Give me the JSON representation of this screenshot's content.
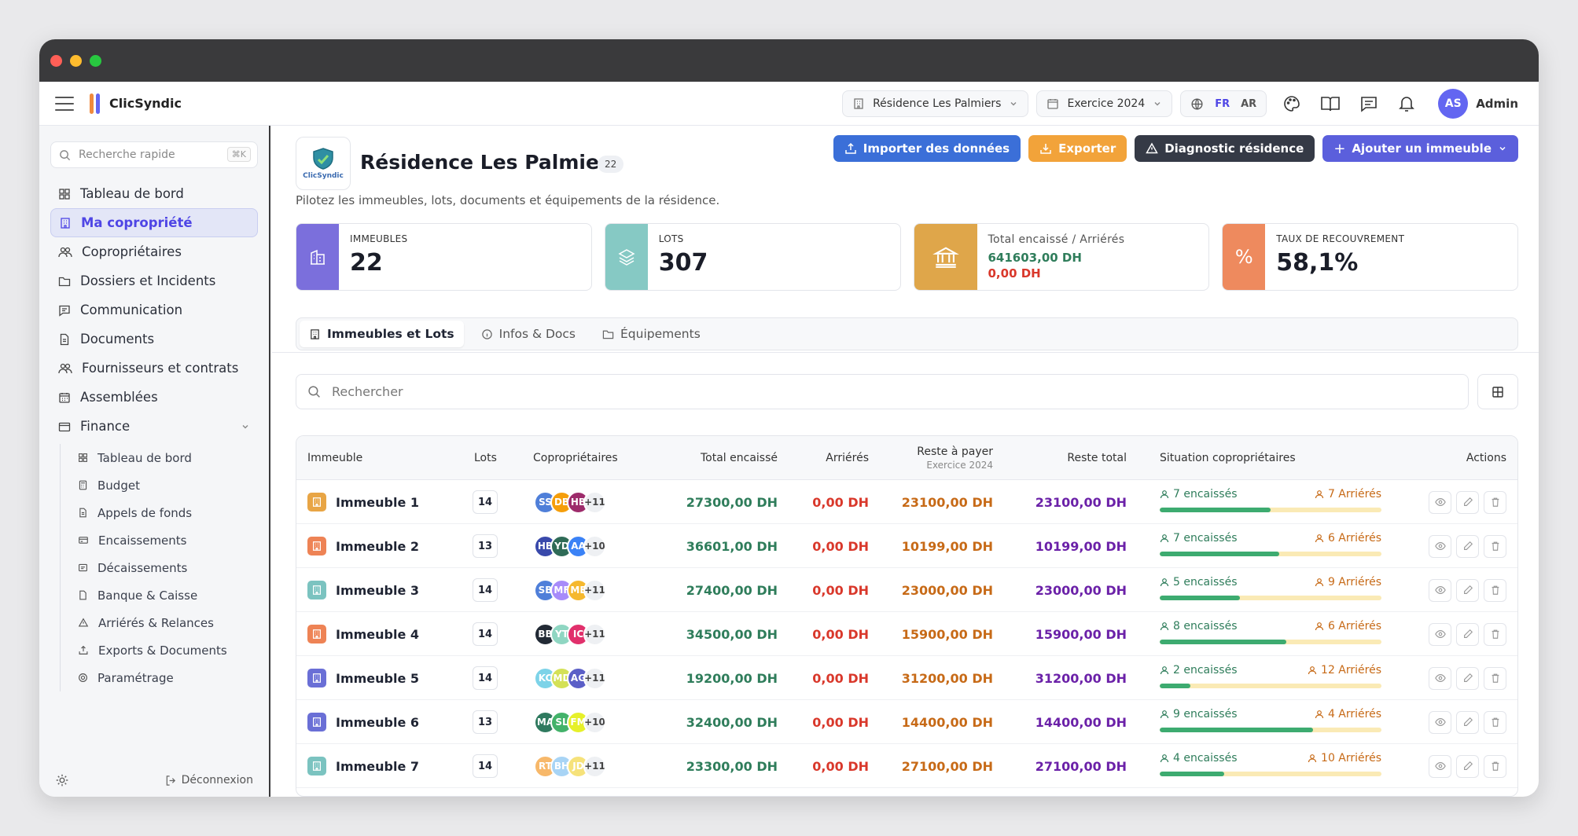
{
  "app": {
    "brand": "ClicSyndic",
    "admin_label": "Admin",
    "admin_initials": "AS",
    "residence_select": "Résidence Les Palmiers",
    "exercise_select": "Exercice 2024",
    "lang_fr": "FR",
    "lang_ar": "AR"
  },
  "sidebar": {
    "search_placeholder": "Recherche rapide",
    "shortcut": "⌘K",
    "items": [
      {
        "label": "Tableau de bord",
        "icon": "grid-icon"
      },
      {
        "label": "Ma copropriété",
        "icon": "building-icon",
        "active": true
      },
      {
        "label": "Copropriétaires",
        "icon": "users-icon"
      },
      {
        "label": "Dossiers et Incidents",
        "icon": "folder-icon"
      },
      {
        "label": "Communication",
        "icon": "message-icon"
      },
      {
        "label": "Documents",
        "icon": "document-icon"
      },
      {
        "label": "Fournisseurs et contrats",
        "icon": "users-icon"
      },
      {
        "label": "Assemblées",
        "icon": "calendar-icon"
      },
      {
        "label": "Finance",
        "icon": "wallet-icon"
      }
    ],
    "finance_sub": [
      "Tableau de bord",
      "Budget",
      "Appels de fonds",
      "Encaissements",
      "Décaissements",
      "Banque & Caisse",
      "Arriérés & Relances",
      "Exports & Documents",
      "Paramétrage"
    ],
    "logout": "Déconnexion"
  },
  "header": {
    "title": "Résidence Les Palmiers",
    "count": "22",
    "subtitle": "Pilotez les immeubles, lots, documents et équipements de la résidence.",
    "logo_text": "ClicSyndic",
    "buttons": {
      "import": "Importer des données",
      "export": "Exporter",
      "diagnostic": "Diagnostic résidence",
      "add": "Ajouter un immeuble"
    }
  },
  "kpis": {
    "immeubles_label": "IMMEUBLES",
    "immeubles_value": "22",
    "lots_label": "LOTS",
    "lots_value": "307",
    "total_label": "Total encaissé / Arriérés",
    "total_value": "641603,00 DH",
    "arrieres_value": "0,00 DH",
    "taux_label": "TAUX DE RECOUVREMENT",
    "taux_value": "58,1%"
  },
  "tabs": [
    "Immeubles et Lots",
    "Infos & Docs",
    "Équipements"
  ],
  "search_placeholder": "Rechercher",
  "table": {
    "headers": {
      "immeuble": "Immeuble",
      "lots": "Lots",
      "coproprietaires": "Copropriétaires",
      "total": "Total encaissé",
      "arrieres": "Arriérés",
      "reste": "Reste à payer",
      "reste_sub": "Exercice 2024",
      "reste_total": "Reste total",
      "situation": "Situation copropriétaires",
      "actions": "Actions"
    },
    "rows": [
      {
        "name": "Immeuble 1",
        "color": "#e8a545",
        "lots": "14",
        "avatars": [
          [
            "SS",
            "#4f7fd9"
          ],
          [
            "DB",
            "#f59e0b"
          ],
          [
            "HB",
            "#9d2b6b"
          ]
        ],
        "more": "+11",
        "total": "27300,00 DH",
        "arrieres": "0,00 DH",
        "reste": "23100,00 DH",
        "reste_total": "23100,00 DH",
        "enc": "7 encaissés",
        "arr": "7 Arriérés",
        "pct": 50
      },
      {
        "name": "Immeuble 2",
        "color": "#ee8355",
        "lots": "13",
        "avatars": [
          [
            "HB",
            "#3949ab"
          ],
          [
            "YD",
            "#2f6b57"
          ],
          [
            "AA",
            "#3b82f6"
          ]
        ],
        "more": "+10",
        "total": "36601,00 DH",
        "arrieres": "0,00 DH",
        "reste": "10199,00 DH",
        "reste_total": "10199,00 DH",
        "enc": "7 encaissés",
        "arr": "6 Arriérés",
        "pct": 54
      },
      {
        "name": "Immeuble 3",
        "color": "#7bc3c0",
        "lots": "14",
        "avatars": [
          [
            "SB",
            "#4f7fd9"
          ],
          [
            "MF",
            "#a78bfa"
          ],
          [
            "ME",
            "#f5b82e"
          ]
        ],
        "more": "+11",
        "total": "27400,00 DH",
        "arrieres": "0,00 DH",
        "reste": "23000,00 DH",
        "reste_total": "23000,00 DH",
        "enc": "5 encaissés",
        "arr": "9 Arriérés",
        "pct": 36
      },
      {
        "name": "Immeuble 4",
        "color": "#ee8355",
        "lots": "14",
        "avatars": [
          [
            "BB",
            "#222a35"
          ],
          [
            "YT",
            "#8fd6c2"
          ],
          [
            "IC",
            "#e1306c"
          ]
        ],
        "more": "+11",
        "total": "34500,00 DH",
        "arrieres": "0,00 DH",
        "reste": "15900,00 DH",
        "reste_total": "15900,00 DH",
        "enc": "8 encaissés",
        "arr": "6 Arriérés",
        "pct": 57
      },
      {
        "name": "Immeuble 5",
        "color": "#6a6fd6",
        "lots": "14",
        "avatars": [
          [
            "KC",
            "#7dd3e8"
          ],
          [
            "MD",
            "#d4e157"
          ],
          [
            "AG",
            "#5b5fc7"
          ]
        ],
        "more": "+11",
        "total": "19200,00 DH",
        "arrieres": "0,00 DH",
        "reste": "31200,00 DH",
        "reste_total": "31200,00 DH",
        "enc": "2 encaissés",
        "arr": "12 Arriérés",
        "pct": 14
      },
      {
        "name": "Immeuble 6",
        "color": "#6a6fd6",
        "lots": "13",
        "avatars": [
          [
            "MA",
            "#2f7a5f"
          ],
          [
            "SL",
            "#43b26a"
          ],
          [
            "FM",
            "#e6f02a"
          ]
        ],
        "more": "+10",
        "total": "32400,00 DH",
        "arrieres": "0,00 DH",
        "reste": "14400,00 DH",
        "reste_total": "14400,00 DH",
        "enc": "9 encaissés",
        "arr": "4 Arriérés",
        "pct": 69
      },
      {
        "name": "Immeuble 7",
        "color": "#7bc3c0",
        "lots": "14",
        "avatars": [
          [
            "RT",
            "#f7b86a"
          ],
          [
            "BH",
            "#a8d4f5"
          ],
          [
            "JD",
            "#f6e27a"
          ]
        ],
        "more": "+11",
        "total": "23300,00 DH",
        "arrieres": "0,00 DH",
        "reste": "27100,00 DH",
        "reste_total": "27100,00 DH",
        "enc": "4 encaissés",
        "arr": "10 Arriérés",
        "pct": 29
      }
    ]
  },
  "colors": {
    "green": "#2f7d5b",
    "red": "#d9382b",
    "orange": "#c76a17",
    "purple": "#6b21a8",
    "accent": "#4f46e5"
  }
}
